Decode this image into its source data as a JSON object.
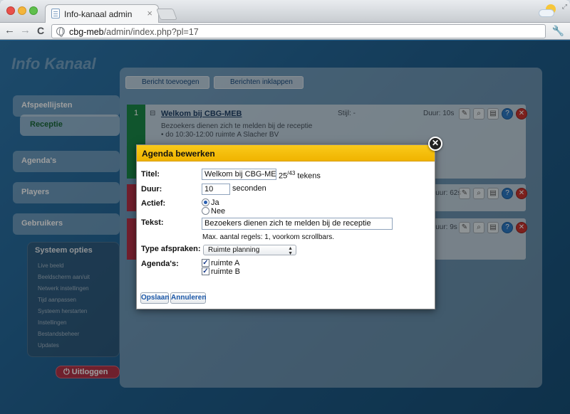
{
  "browser": {
    "tab_title": "Info-kanaal admin",
    "tab_close": "×",
    "url_host": "cbg-meb",
    "url_path": "/admin/index.php?pl=17",
    "back": "←",
    "forward": "→",
    "reload": "C",
    "wrench": "🔧"
  },
  "app": {
    "logo": "Info Kanaal",
    "sidebar": {
      "items": [
        {
          "label": "Afspeellijsten"
        },
        {
          "label": "Receptie"
        },
        {
          "label": "Agenda's"
        },
        {
          "label": "Players"
        },
        {
          "label": "Gebruikers"
        }
      ],
      "system_title": "Systeem opties",
      "system_items": [
        "Live beeld",
        "Beeldscherm aan/uit",
        "Netwerk instellingen",
        "Tijd aanpassen",
        "Systeem herstarten",
        "Instellingen",
        "Bestandsbeheer",
        "Updates"
      ],
      "logout": "Uitloggen"
    },
    "toolbar": {
      "add_message": "Bericht toevoegen",
      "collapse_messages": "Berichten inklappen"
    },
    "rows": [
      {
        "number": "1",
        "title": "Welkom bij CBG-MEB",
        "style": "Stijl: -",
        "duration": "Duur: 10s",
        "text_line1": "Bezoekers dienen zich te melden bij de receptie",
        "text_line2": "• do 10:30-12:00  ruimte A  Slacher BV"
      },
      {
        "duration": "Duur: 62s"
      },
      {
        "duration": "Duur: 9s"
      }
    ]
  },
  "modal": {
    "title": "Agenda bewerken",
    "close": "✕",
    "labels": {
      "title": "Titel:",
      "duration": "Duur:",
      "active": "Actief:",
      "text": "Tekst:",
      "type": "Type afspraken:",
      "agendas": "Agenda's:"
    },
    "title_value": "Welkom bij CBG-MEB",
    "title_count": "25",
    "title_max": "/43",
    "title_unit": " tekens",
    "duration_value": "10",
    "duration_unit": "seconden",
    "active_yes": "Ja",
    "active_no": "Nee",
    "text_value": "Bezoekers dienen zich te melden bij de receptie",
    "text_hint": "Max. aantal regels: 1, voorkom scrollbars.",
    "type_value": "Ruimte planning",
    "agenda_a": "ruimte A",
    "agenda_b": "ruimte B",
    "save": "Opslaan",
    "cancel": "Annuleren"
  }
}
